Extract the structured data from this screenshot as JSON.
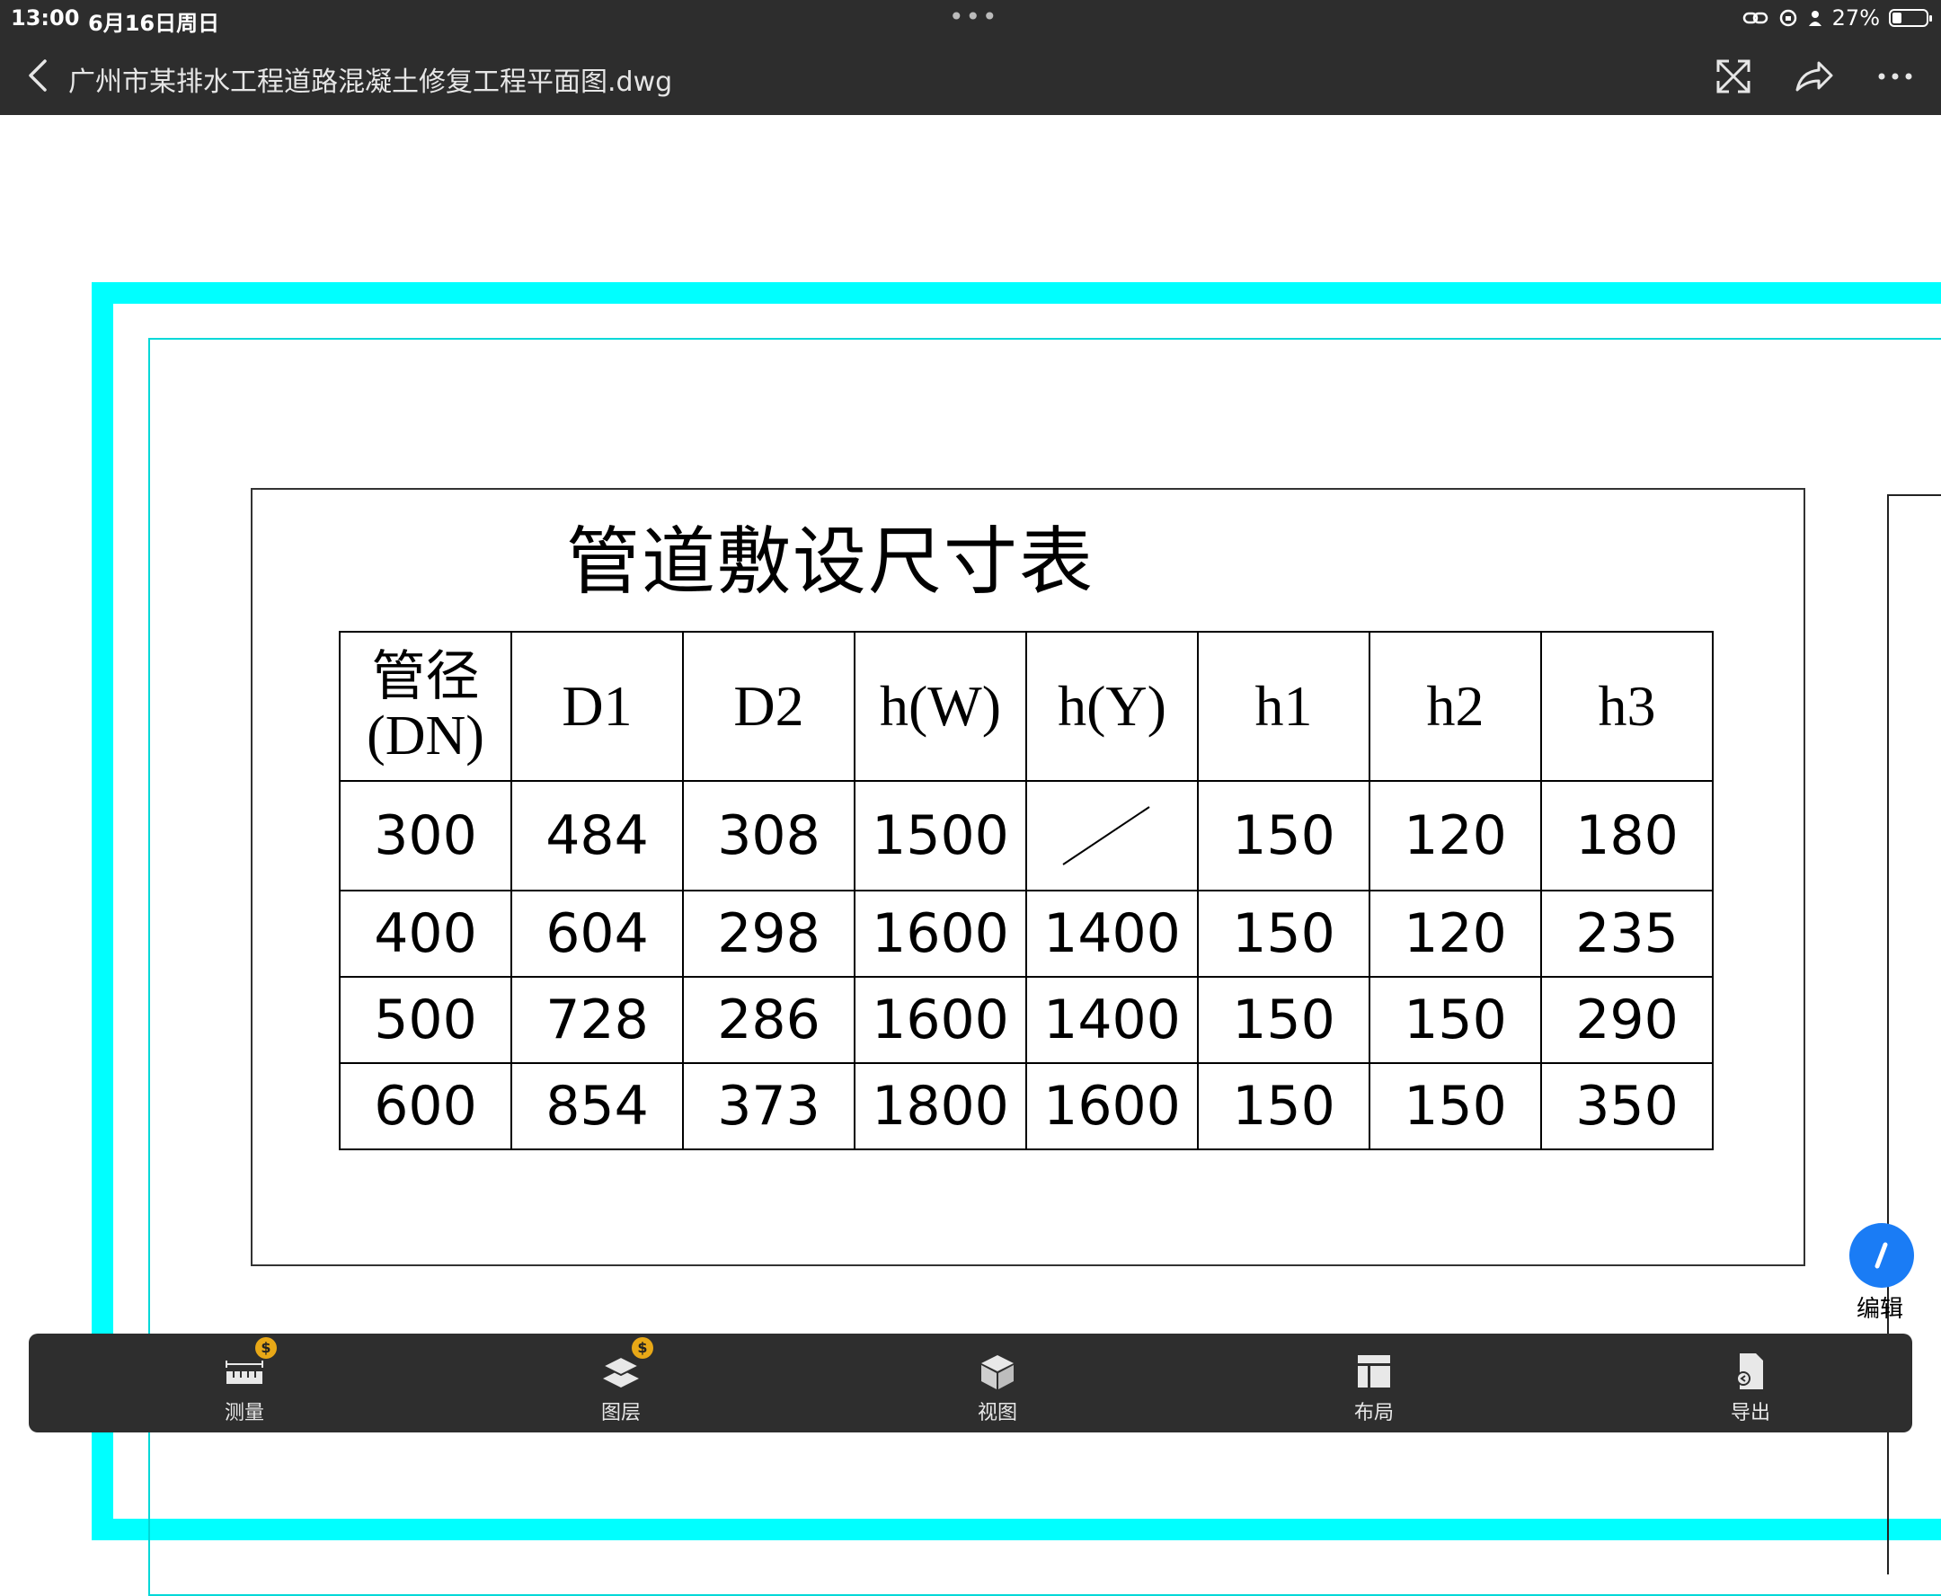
{
  "status": {
    "time": "13:00",
    "date": "6月16日周日",
    "battery": "27%",
    "battery_level": 0.27
  },
  "header": {
    "title": "广州市某排水工程道路混凝土修复工程平面图.dwg"
  },
  "drawing": {
    "table_title": "管道敷设尺寸表",
    "headers": [
      "管径\n(DN)",
      "D1",
      "D2",
      "h(W)",
      "h(Y)",
      "h1",
      "h2",
      "h3"
    ],
    "rows": [
      [
        "300",
        "484",
        "308",
        "1500",
        "",
        "150",
        "120",
        "180"
      ],
      [
        "400",
        "604",
        "298",
        "1600",
        "1400",
        "150",
        "120",
        "235"
      ],
      [
        "500",
        "728",
        "286",
        "1600",
        "1400",
        "150",
        "150",
        "290"
      ],
      [
        "600",
        "854",
        "373",
        "1800",
        "1600",
        "150",
        "150",
        "350"
      ]
    ]
  },
  "fab": {
    "label": "编辑"
  },
  "toolbar": {
    "items": [
      {
        "label": "测量",
        "icon": "ruler-icon",
        "badge": "$"
      },
      {
        "label": "图层",
        "icon": "layers-icon",
        "badge": "$"
      },
      {
        "label": "视图",
        "icon": "cube-icon"
      },
      {
        "label": "布局",
        "icon": "layout-icon"
      },
      {
        "label": "导出",
        "icon": "export-icon"
      }
    ]
  },
  "colors": {
    "frame": "#00ffff",
    "topbar": "#2d2d2d",
    "toolbar": "#2e2e2e",
    "accent": "#1a7cf5",
    "badge": "#e8a817"
  }
}
